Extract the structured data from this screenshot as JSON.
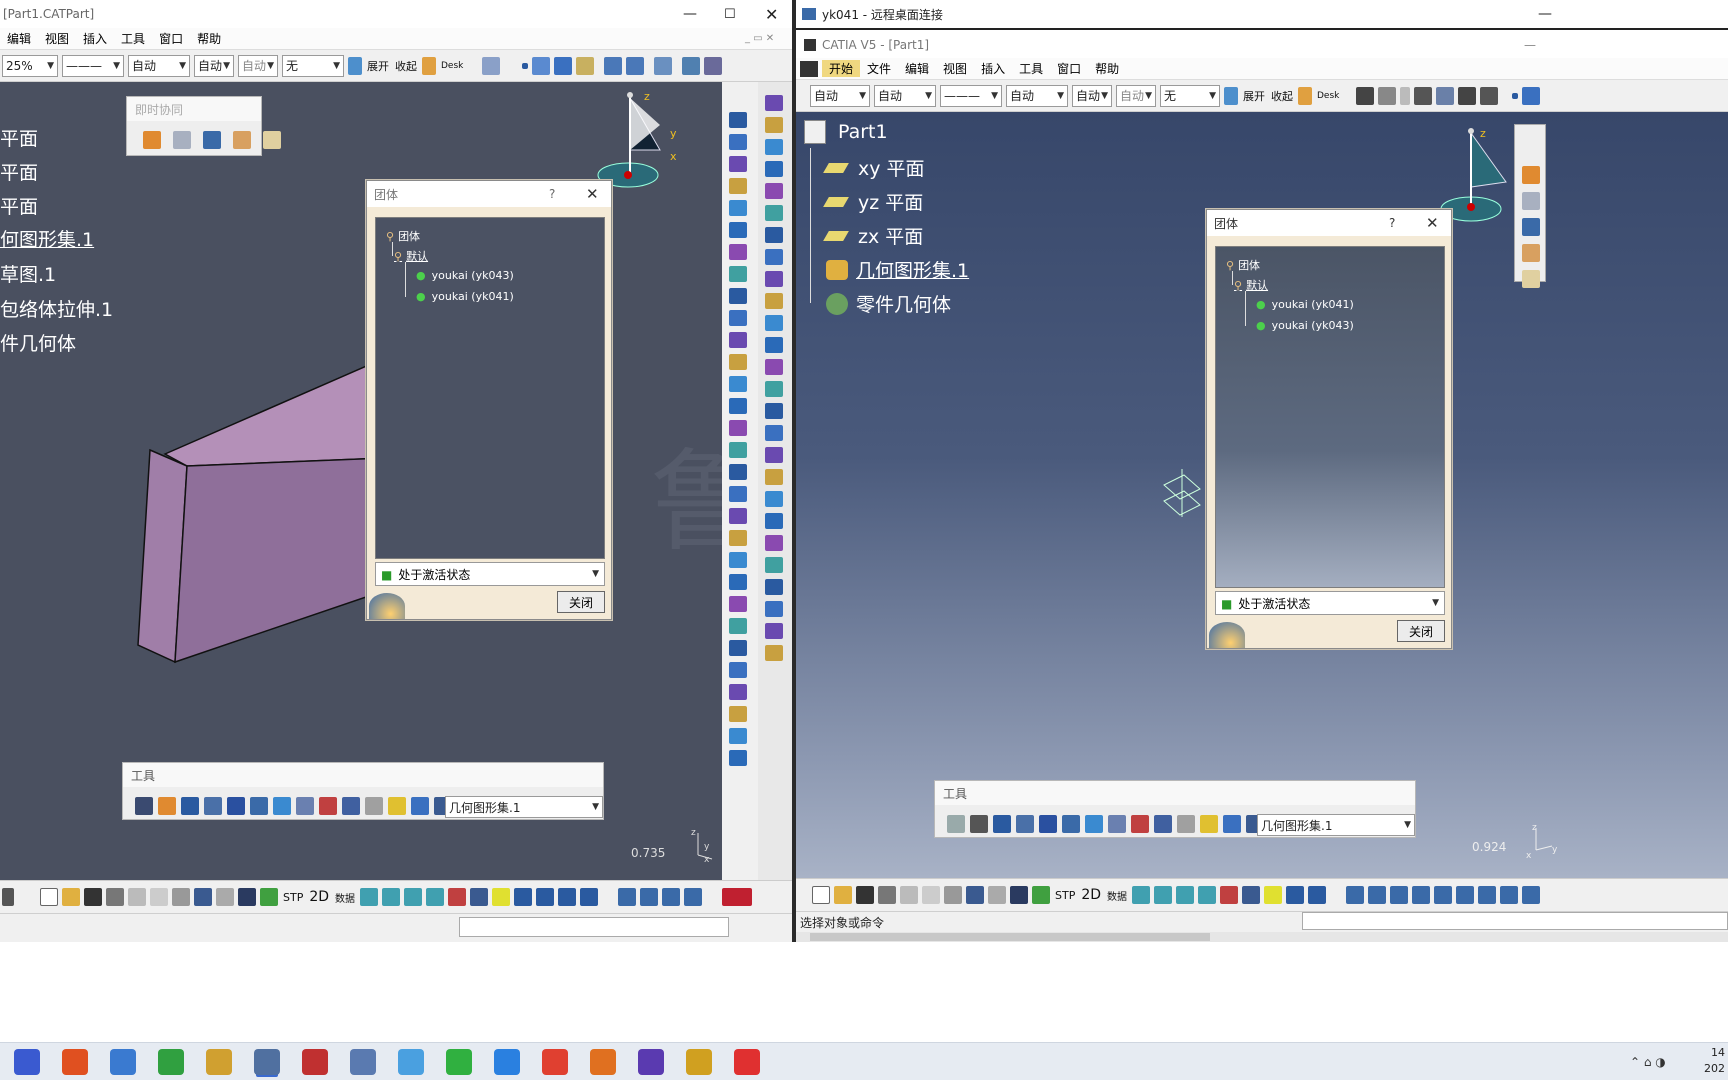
{
  "left": {
    "title": "[Part1.CATPart]",
    "menu": [
      "编辑",
      "视图",
      "插入",
      "工具",
      "窗口",
      "帮助"
    ],
    "zoom": "25%",
    "combos": [
      "———",
      "自动",
      "自动",
      "自动",
      "无"
    ],
    "expand": "展开",
    "collapse": "收起",
    "desk": "Desk",
    "tree": [
      "平面",
      "平面",
      "平面",
      "何图形集.1",
      "草图.1",
      "包络体拉伸.1",
      "件几何体"
    ],
    "collab_title": "即时协同",
    "dialog": {
      "title": "团体",
      "help": "?",
      "root": "团体",
      "group": "默认",
      "members": [
        "youkai (yk043)",
        "youkai (yk041)"
      ],
      "state": "处于激活状态",
      "close": "关闭"
    },
    "tools_title": "工具",
    "tools_combo": "几何图形集.1",
    "scale": "0.735",
    "bottom_labels": {
      "stp": "STP",
      "twod": "2D",
      "data": "数据"
    }
  },
  "right": {
    "rdp_title": "yk041 - 远程桌面连接",
    "catia_title": "CATIA V5 - [Part1]",
    "menu": [
      "开始",
      "文件",
      "编辑",
      "视图",
      "插入",
      "工具",
      "窗口",
      "帮助"
    ],
    "combos": [
      "自动",
      "自动",
      "———",
      "自动",
      "自动",
      "自动",
      "无"
    ],
    "expand": "展开",
    "collapse": "收起",
    "desk": "Desk",
    "tree_root": "Part1",
    "tree": [
      "xy 平面",
      "yz 平面",
      "zx 平面",
      "几何图形集.1",
      "零件几何体"
    ],
    "dialog": {
      "title": "团体",
      "help": "?",
      "root": "团体",
      "group": "默认",
      "members": [
        "youkai (yk041)",
        "youkai (yk043)"
      ],
      "state": "处于激活状态",
      "close": "关闭"
    },
    "tools_title": "工具",
    "tools_combo": "几何图形集.1",
    "scale": "0.924",
    "status": "选择对象或命令",
    "bottom_labels": {
      "stp": "STP",
      "twod": "2D",
      "data": "数据"
    }
  },
  "axis": {
    "x": "x",
    "y": "y",
    "z": "z"
  },
  "taskbar": {
    "clock_time": "14",
    "clock_date": "202"
  },
  "watermark": "鲁少"
}
